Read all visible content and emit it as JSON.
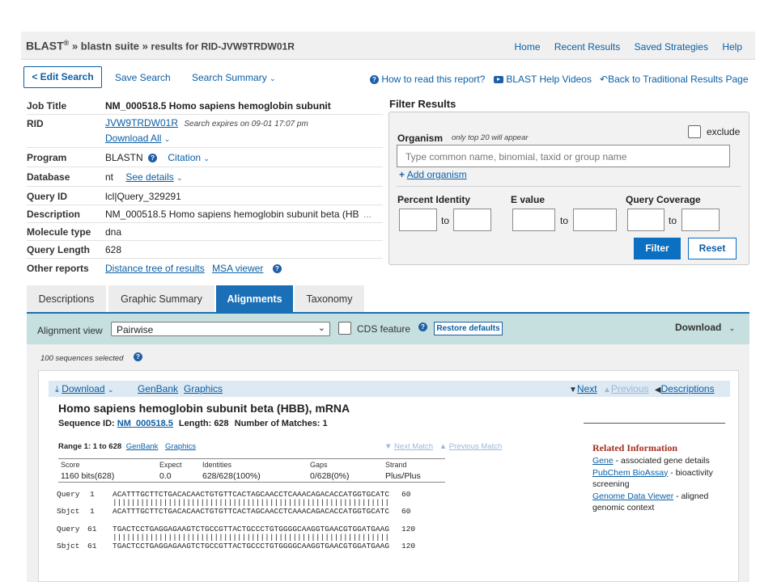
{
  "header": {
    "brand": "BLAST",
    "reg": "®",
    "sep1": "»",
    "suite": "blastn suite",
    "sep2": "»",
    "results": "results for RID-JVW9TRDW01R",
    "nav": [
      "Home",
      "Recent Results",
      "Saved Strategies",
      "Help"
    ]
  },
  "toolbar": {
    "edit_search": "< Edit Search",
    "save_search": "Save Search",
    "search_summary": "Search Summary",
    "how_to_read": "How to read this report?",
    "help_videos": "BLAST Help Videos",
    "back_traditional": "Back to Traditional Results Page"
  },
  "summary": {
    "job_title_label": "Job Title",
    "job_title": "NM_000518.5 Homo sapiens hemoglobin subunit",
    "rid_label": "RID",
    "rid": "JVW9TRDW01R",
    "rid_expires": "Search expires on 09-01 17:07 pm",
    "download_all": "Download All",
    "program_label": "Program",
    "program": "BLASTN",
    "citation": "Citation",
    "database_label": "Database",
    "database": "nt",
    "see_details": "See details",
    "query_id_label": "Query ID",
    "query_id": "lcl|Query_329291",
    "description_label": "Description",
    "description": "NM_000518.5 Homo sapiens hemoglobin subunit beta (HB",
    "ellipsis": "...",
    "molecule_label": "Molecule type",
    "molecule": "dna",
    "query_length_label": "Query Length",
    "query_length": "628",
    "other_reports_label": "Other reports",
    "distance_tree": "Distance tree of results",
    "msa_viewer": "MSA viewer"
  },
  "filter": {
    "title": "Filter Results",
    "organism_label": "Organism",
    "organism_hint": "only top 20 will appear",
    "exclude_label": "exclude",
    "organism_placeholder": "Type common  name, binomial, taxid or group  name",
    "add_organism": "Add organism",
    "percent_identity": "Percent Identity",
    "evalue": "E value",
    "query_coverage": "Query Coverage",
    "to": "to",
    "filter_button": "Filter",
    "reset_button": "Reset"
  },
  "tabs": [
    "Descriptions",
    "Graphic Summary",
    "Alignments",
    "Taxonomy"
  ],
  "active_tab": "Alignments",
  "alignment_bar": {
    "view_label": "Alignment view",
    "view_value": "Pairwise",
    "cds_feature": "CDS feature",
    "restore_defaults": "Restore defaults",
    "download": "Download"
  },
  "selected_text": "100 sequences selected",
  "card": {
    "download": "Download",
    "genbank": "GenBank",
    "graphics": "Graphics",
    "next": "Next",
    "previous": "Previous",
    "descriptions": "Descriptions",
    "title": "Homo sapiens hemoglobin subunit beta (HBB), mRNA",
    "seqid_label": "Sequence ID:",
    "seqid": "NM_000518.5",
    "length_label": "Length:",
    "length": "628",
    "matches_label": "Number of Matches:",
    "matches": "1",
    "range": "Range 1: 1 to 628",
    "range_genbank": "GenBank",
    "range_graphics": "Graphics",
    "next_match": "Next Match",
    "previous_match": "Previous Match",
    "stats_headers": [
      "Score",
      "Expect",
      "Identities",
      "Gaps",
      "Strand"
    ],
    "stats_values": [
      "1160 bits(628)",
      "0.0",
      "628/628(100%)",
      "0/628(0%)",
      "Plus/Plus"
    ],
    "alignment": [
      {
        "q_label": "Query",
        "q_start": "1",
        "q_seq": "ACATTTGCTTCTGACACAACTGTGTTCACTAGCAACCTCAAACAGACACCATGGTGCATC",
        "q_end": "60",
        "bars": "||||||||||||||||||||||||||||||||||||||||||||||||||||||||||||",
        "s_label": "Sbjct",
        "s_start": "1",
        "s_seq": "ACATTTGCTTCTGACACAACTGTGTTCACTAGCAACCTCAAACAGACACCATGGTGCATC",
        "s_end": "60"
      },
      {
        "q_label": "Query",
        "q_start": "61",
        "q_seq": "TGACTCCTGAGGAGAAGTCTGCCGTTACTGCCCTGTGGGGCAAGGTGAACGTGGATGAAG",
        "q_end": "120",
        "bars": "||||||||||||||||||||||||||||||||||||||||||||||||||||||||||||",
        "s_label": "Sbjct",
        "s_start": "61",
        "s_seq": "TGACTCCTGAGGAGAAGTCTGCCGTTACTGCCCTGTGGGGCAAGGTGAACGTGGATGAAG",
        "s_end": "120"
      }
    ],
    "related_title": "Related Information",
    "related": [
      {
        "link": "Gene",
        "text": " - associated gene details"
      },
      {
        "link": "PubChem BioAssay",
        "text": " - bioactivity screening"
      },
      {
        "link": "Genome Data Viewer",
        "text": " - aligned genomic context"
      }
    ]
  }
}
